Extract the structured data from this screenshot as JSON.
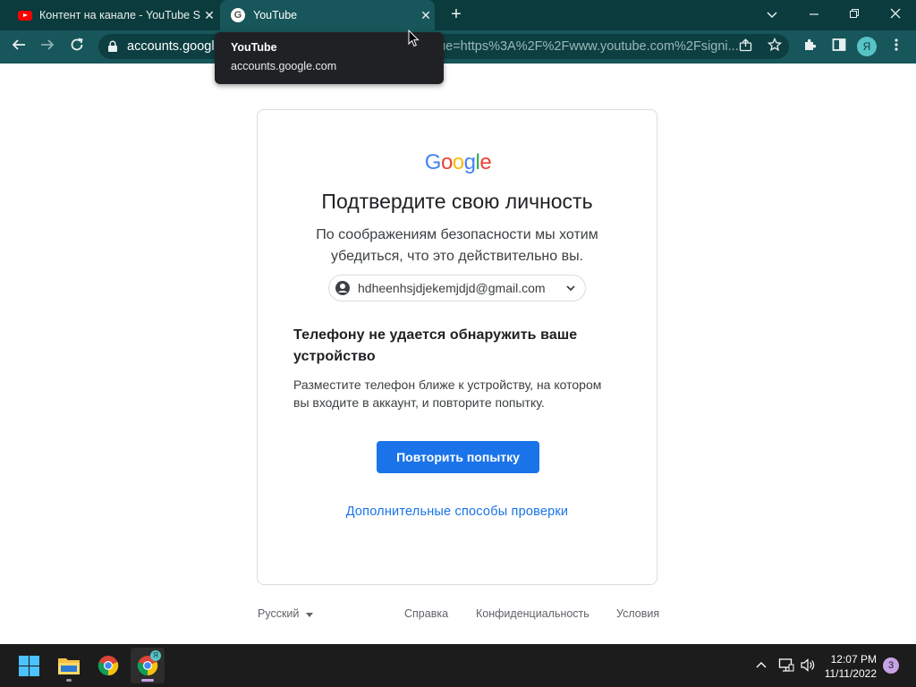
{
  "browser": {
    "tabs": [
      {
        "title": "Контент на канале - YouTube Studio",
        "favicon": "youtube-favicon",
        "active": false
      },
      {
        "title": "YouTube",
        "favicon": "google-favicon",
        "active": true
      }
    ],
    "address": {
      "host": "accounts.google",
      "tail": "nue=https%3A%2F%2Fwww.youtube.com%2Fsigni..."
    },
    "profile_initial": "Я",
    "tooltip": {
      "title": "YouTube",
      "host": "accounts.google.com"
    }
  },
  "page": {
    "logo": [
      "G",
      "o",
      "o",
      "g",
      "l",
      "e"
    ],
    "logo_colors": [
      "#4285f4",
      "#ea4335",
      "#fbbc05",
      "#4285f4",
      "#34a853",
      "#ea4335"
    ],
    "heading": "Подтвердите свою личность",
    "subtext_line1": "По соображениям безопасности мы хотим",
    "subtext_line2": "убедиться, что это действительно вы.",
    "account_email": "hdheenhsjdjekemjdjd@gmail.com",
    "section_heading_line1": "Телефону не удается обнаружить ваше",
    "section_heading_line2": "устройство",
    "section_body_line1": "Разместите телефон ближе к устройству, на котором",
    "section_body_line2": "вы входите в аккаунт, и повторите попытку.",
    "retry_button": "Повторить попытку",
    "more_ways_link": "Дополнительные способы проверки"
  },
  "footer": {
    "language": "Русский",
    "help": "Справка",
    "privacy": "Конфиденциальность",
    "terms": "Условия"
  },
  "taskbar": {
    "time": "12:07 PM",
    "date": "11/11/2022",
    "notification_count": "3",
    "chrome_badge": "Я"
  }
}
